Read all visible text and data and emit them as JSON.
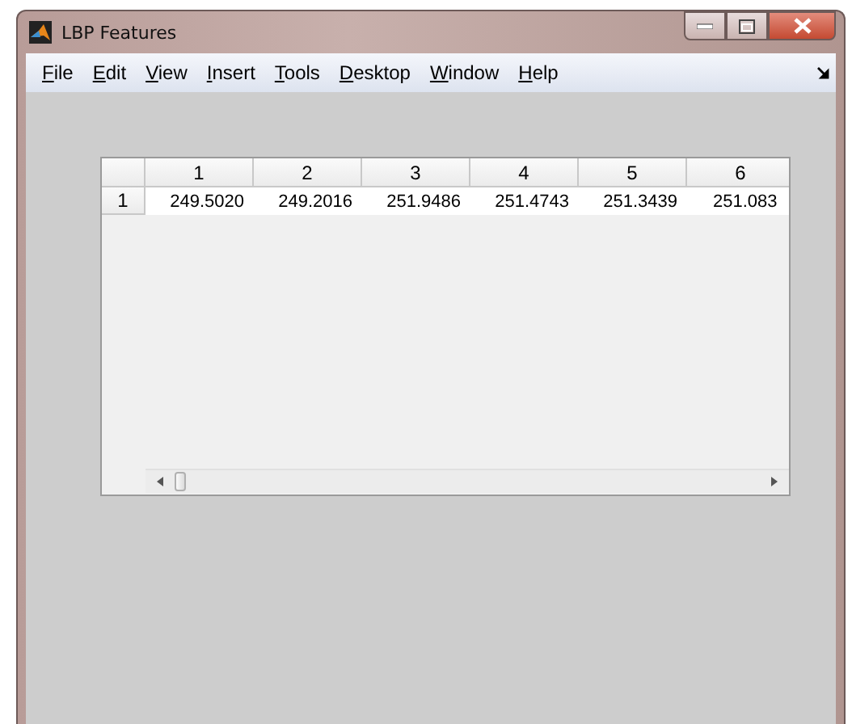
{
  "window": {
    "title": "LBP Features"
  },
  "menu": [
    "File",
    "Edit",
    "View",
    "Insert",
    "Tools",
    "Desktop",
    "Window",
    "Help"
  ],
  "table": {
    "columns": [
      "1",
      "2",
      "3",
      "4",
      "5",
      "6"
    ],
    "rows": [
      {
        "header": "1",
        "cells": [
          "249.5020",
          "249.2016",
          "251.9486",
          "251.4743",
          "251.3439",
          "251.083"
        ]
      }
    ]
  }
}
